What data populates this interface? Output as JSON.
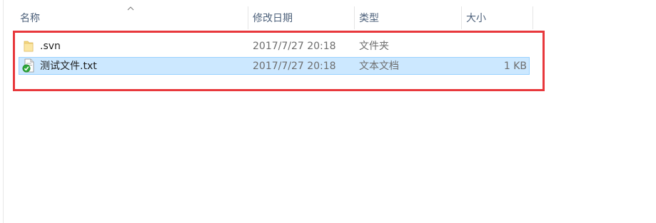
{
  "columns": {
    "name": "名称",
    "modified": "修改日期",
    "type": "类型",
    "size": "大小"
  },
  "files": [
    {
      "name": ".svn",
      "modified": "2017/7/27 20:18",
      "type": "文件夹",
      "size": "",
      "icon": "folder-icon",
      "selected": false
    },
    {
      "name": "测试文件.txt",
      "modified": "2017/7/27 20:18",
      "type": "文本文档",
      "size": "1 KB",
      "icon": "svn-normal-text-file-icon",
      "selected": true
    }
  ],
  "colors": {
    "selection_background": "#cce8ff",
    "selection_border": "#99d1ff",
    "highlight_frame": "#e8383c",
    "folder": "#f4d77e",
    "svn_check": "#2ea83a"
  }
}
